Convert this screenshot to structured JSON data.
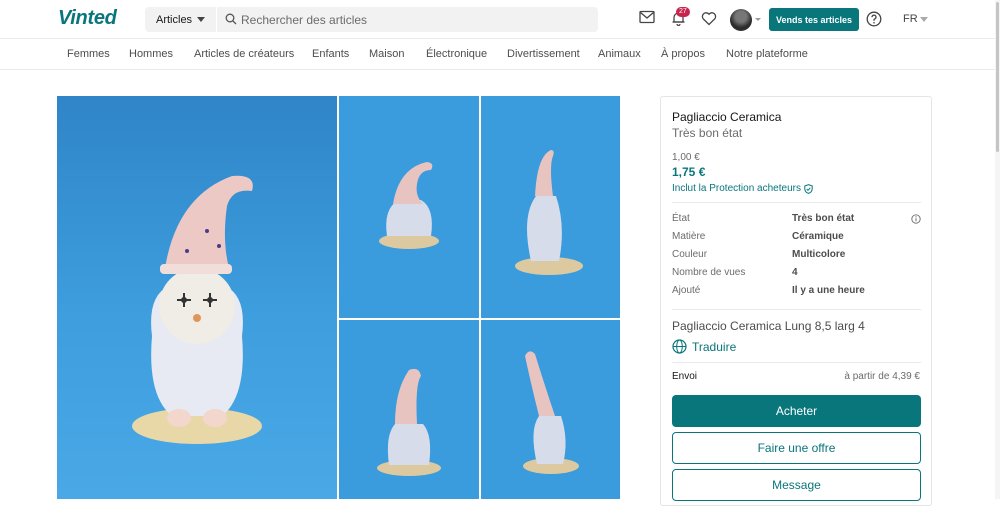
{
  "header": {
    "logo": "Vinted",
    "category_select": "Articles",
    "search_placeholder": "Rechercher des articles",
    "notifications_count": "27",
    "sell_button": "Vends tes articles",
    "language": "FR"
  },
  "nav": {
    "items": [
      "Femmes",
      "Hommes",
      "Articles de créateurs",
      "Enfants",
      "Maison",
      "Électronique",
      "Divertissement",
      "Animaux",
      "À propos",
      "Notre plateforme"
    ]
  },
  "item": {
    "title": "Pagliaccio Ceramica",
    "condition": "Très bon état",
    "price": "1,00 €",
    "price_with_protection": "1,75 €",
    "protection_label": "Inclut la Protection acheteurs",
    "details": [
      {
        "label": "État",
        "value": "Très bon état"
      },
      {
        "label": "Matière",
        "value": "Céramique"
      },
      {
        "label": "Couleur",
        "value": "Multicolore"
      },
      {
        "label": "Nombre de vues",
        "value": "4"
      },
      {
        "label": "Ajouté",
        "value": "Il y a une heure"
      }
    ],
    "description": "Pagliaccio Ceramica Lung 8,5 larg 4",
    "translate_label": "Traduire",
    "shipping_label": "Envoi",
    "shipping_value": "à partir de 4,39 €",
    "buy_button": "Acheter",
    "offer_button": "Faire une offre",
    "message_button": "Message"
  },
  "colors": {
    "brand": "#09767c",
    "badge": "#c7254e",
    "photo_background": "#3b9ad9"
  },
  "icons": [
    "chevron-down-icon",
    "search-icon",
    "mail-icon",
    "bell-icon",
    "heart-icon",
    "help-icon",
    "shield-check-icon",
    "info-icon",
    "globe-icon"
  ]
}
